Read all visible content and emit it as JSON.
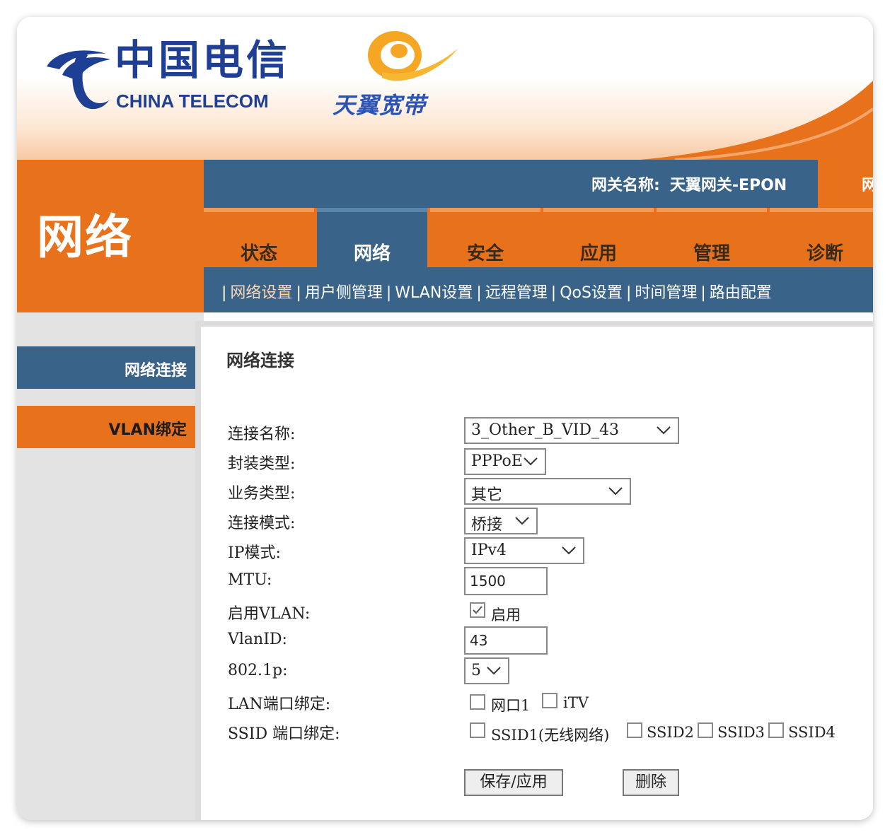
{
  "header": {
    "logo_cn": "中国电信",
    "logo_en": "CHINA TELECOM",
    "brand": "天翼宽带"
  },
  "section": {
    "title": "网络"
  },
  "topbar": {
    "gateway_label": "网关名称:",
    "gateway_value": "天翼网关-EPON",
    "right_text": "网"
  },
  "tabs": [
    {
      "label": "状态"
    },
    {
      "label": "网络"
    },
    {
      "label": "安全"
    },
    {
      "label": "应用"
    },
    {
      "label": "管理"
    },
    {
      "label": "诊断"
    }
  ],
  "subnav": {
    "items": [
      "网络设置",
      "用户侧管理",
      "WLAN设置",
      "远程管理",
      "QoS设置",
      "时间管理",
      "路由配置"
    ]
  },
  "sidebar": {
    "items": [
      {
        "label": "网络连接"
      },
      {
        "label": "VLAN绑定"
      }
    ]
  },
  "content": {
    "title": "网络连接",
    "fields": {
      "conn_name": {
        "label": "连接名称:",
        "value": "3_Other_B_VID_43"
      },
      "encap": {
        "label": "封装类型:",
        "value": "PPPoE"
      },
      "service": {
        "label": "业务类型:",
        "value": "其它"
      },
      "mode": {
        "label": "连接模式:",
        "value": "桥接"
      },
      "ip_mode": {
        "label": "IP模式:",
        "value": "IPv4"
      },
      "mtu": {
        "label": "MTU:",
        "value": "1500"
      },
      "vlan_enable": {
        "label": "启用VLAN:",
        "option": "启用",
        "checked": true
      },
      "vlan_id": {
        "label": "VlanID:",
        "value": "43"
      },
      "dot1p": {
        "label": "802.1p:",
        "value": "5"
      },
      "lan_bind": {
        "label": "LAN端口绑定:",
        "options": [
          "网口1",
          "iTV"
        ]
      },
      "ssid_bind": {
        "label": "SSID 端口绑定:",
        "options": [
          "SSID1(无线网络)",
          "SSID2",
          "SSID3",
          "SSID4"
        ]
      }
    },
    "buttons": {
      "save": "保存/应用",
      "delete": "删除"
    }
  },
  "colors": {
    "orange": "#e8721c",
    "blue": "#3a6389",
    "logo_blue": "#1f3f94"
  }
}
